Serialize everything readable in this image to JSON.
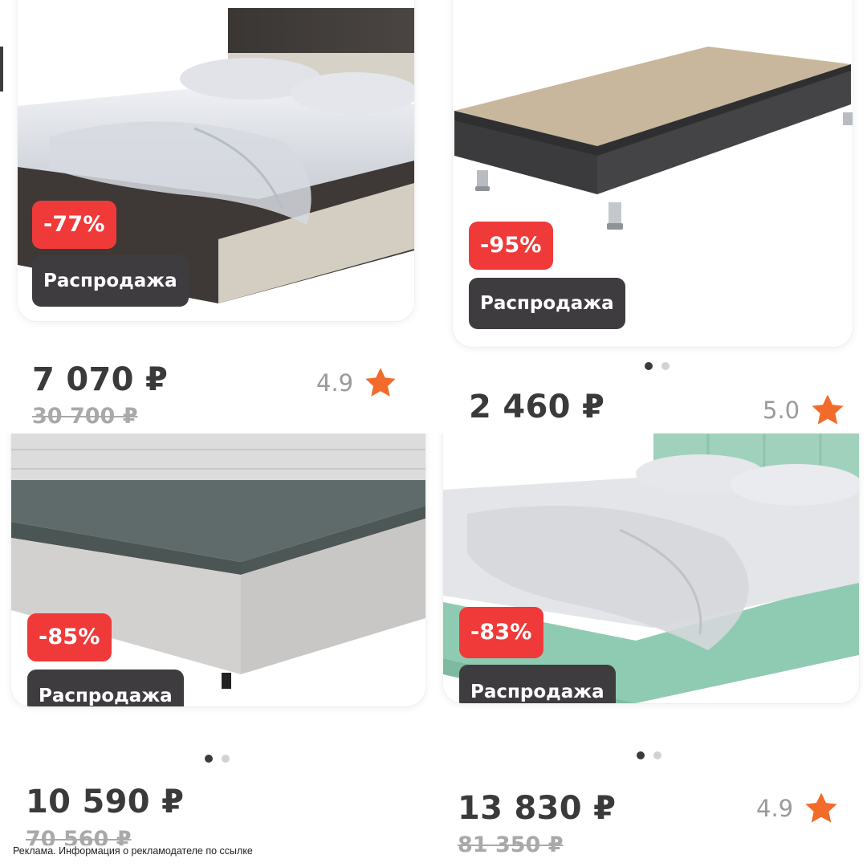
{
  "products": [
    {
      "discount": "-77%",
      "sale_label": "Распродажа",
      "price": "7 070 ₽",
      "old_price": "30 700 ₽",
      "rating": "4.9",
      "image_icon": "bed-with-headboard-and-drawer",
      "carousel": {
        "count": 0
      }
    },
    {
      "discount": "-95%",
      "sale_label": "Распродажа",
      "price": "2 460 ₽",
      "old_price": "",
      "rating": "5.0",
      "image_icon": "box-spring-bed-base",
      "carousel": {
        "count": 2,
        "active": 0
      }
    },
    {
      "discount": "-85%",
      "sale_label": "Распродажа",
      "price": "10 590 ₽",
      "old_price": "70 560 ₽",
      "rating": "",
      "image_icon": "mattress-on-upholstered-base",
      "carousel": {
        "count": 2,
        "active": 0
      }
    },
    {
      "discount": "-83%",
      "sale_label": "Распродажа",
      "price": "13 830 ₽",
      "old_price": "81 350 ₽",
      "rating": "4.9",
      "image_icon": "mint-upholstered-bed",
      "carousel": {
        "count": 2,
        "active": 0
      }
    }
  ],
  "ad_disclaimer": "Реклама. Информация о рекламодателе по ссылке",
  "colors": {
    "discount_badge": "#f03a3a",
    "sale_badge": "#3f3c40",
    "price_text": "#3a3a3a",
    "old_price_text": "#a9a9a9",
    "rating_text": "#9a9a9a",
    "star": "#f26b2a",
    "dot_active": "#3b3b3b",
    "dot_inactive": "#d2d2d2"
  }
}
